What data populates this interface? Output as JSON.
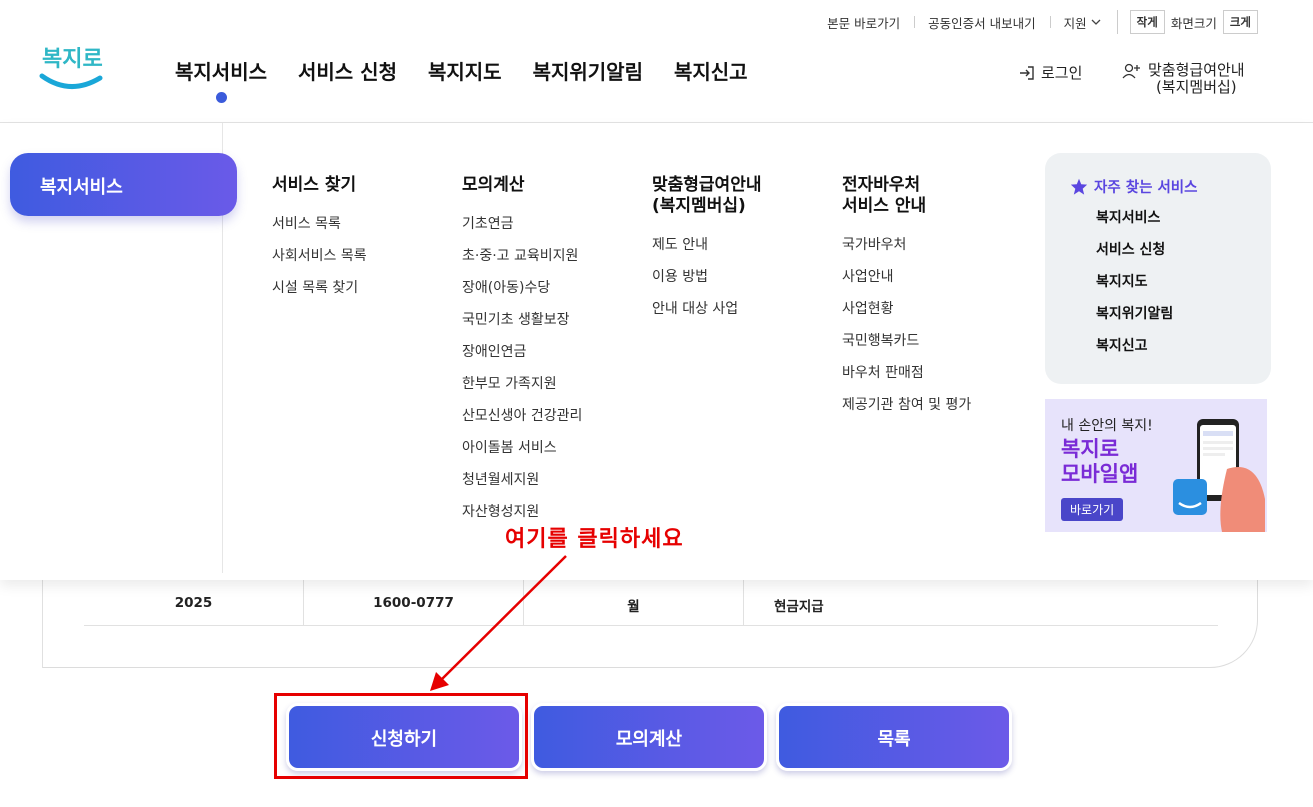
{
  "utility": {
    "skip_link": "본문 바로가기",
    "cert_export": "공동인증서 내보내기",
    "lang": "지원",
    "size_small": "작게",
    "size_label": "화면크기",
    "size_large": "크게"
  },
  "logo": {
    "text": "복지로"
  },
  "gnb": [
    "복지서비스",
    "서비스 신청",
    "복지지도",
    "복지위기알림",
    "복지신고"
  ],
  "header": {
    "login": "로그인",
    "member_line1": "맞춤형급여안내",
    "member_line2": "(복지멤버십)"
  },
  "mega": {
    "active_tab": "복지서비스",
    "columns": [
      {
        "title": "서비스 찾기",
        "items": [
          "서비스 목록",
          "사회서비스 목록",
          "시설 목록 찾기"
        ]
      },
      {
        "title": "모의계산",
        "items": [
          "기초연금",
          "초·중·고 교육비지원",
          "장애(아동)수당",
          "국민기초 생활보장",
          "장애인연금",
          "한부모 가족지원",
          "산모신생아 건강관리",
          "아이돌봄 서비스",
          "청년월세지원",
          "자산형성지원"
        ]
      },
      {
        "title_line1": "맞춤형급여안내",
        "title_line2": "(복지멤버십)",
        "items": [
          "제도 안내",
          "이용 방법",
          "안내 대상 사업"
        ]
      },
      {
        "title_line1": "전자바우처",
        "title_line2": "서비스 안내",
        "items": [
          "국가바우처",
          "사업안내",
          "사업현황",
          "국민행복카드",
          "바우처 판매점",
          "제공기관 참여 및 평가"
        ]
      }
    ],
    "favorites": {
      "title": "자주 찾는 서비스",
      "items": [
        "복지서비스",
        "서비스 신청",
        "복지지도",
        "복지위기알림",
        "복지신고"
      ]
    },
    "banner": {
      "line1": "내 손안의 복지!",
      "line2": "복지로",
      "line3": "모바일앱",
      "button": "바로가기"
    }
  },
  "table_row": [
    "2025",
    "1600-0777",
    "월",
    "현금지급"
  ],
  "buttons": {
    "apply": "신청하기",
    "simulate": "모의계산",
    "list": "목록"
  },
  "annotation": {
    "text": "여기를 클릭하세요"
  },
  "colors": {
    "accent": "#3f5be0",
    "accent2": "#6c5ae8",
    "annotation": "#e60000",
    "dot": "#3b5bdb"
  }
}
